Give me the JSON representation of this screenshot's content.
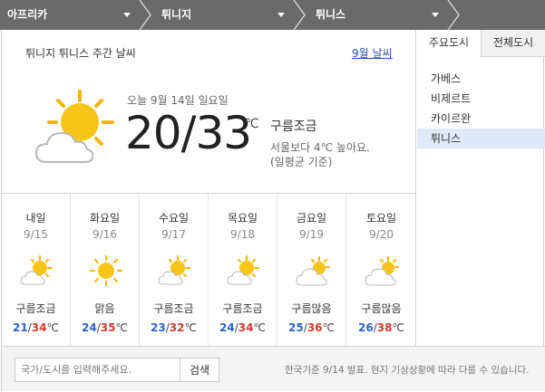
{
  "breadcrumb": {
    "items": [
      {
        "label": "아프리카"
      },
      {
        "label": "튀니지"
      },
      {
        "label": "튀니스"
      }
    ]
  },
  "main": {
    "title": "튀니지 튀니스 주간 날씨",
    "month_link": "9월 날씨"
  },
  "today": {
    "date": "오늘 9월 14일 일요일",
    "temp": "20/33",
    "unit": "℃",
    "condition": "구름조금",
    "compare": "서울보다 4℃ 높아요.",
    "note": "(일평균 기준)",
    "icon": "sun-cloud-icon"
  },
  "forecast": [
    {
      "day": "내일",
      "date": "9/15",
      "icon": "sun-cloud-icon",
      "cond": "구름조금",
      "lo": "21",
      "hi": "34"
    },
    {
      "day": "화요일",
      "date": "9/16",
      "icon": "sun-icon",
      "cond": "맑음",
      "lo": "24",
      "hi": "35"
    },
    {
      "day": "수요일",
      "date": "9/17",
      "icon": "sun-cloud-icon",
      "cond": "구름조금",
      "lo": "23",
      "hi": "32"
    },
    {
      "day": "목요일",
      "date": "9/18",
      "icon": "sun-cloud-icon",
      "cond": "구름조금",
      "lo": "24",
      "hi": "34"
    },
    {
      "day": "금요일",
      "date": "9/19",
      "icon": "cloud-sun-icon",
      "cond": "구름많음",
      "lo": "25",
      "hi": "36"
    },
    {
      "day": "토요일",
      "date": "9/20",
      "icon": "cloud-sun-icon",
      "cond": "구름많음",
      "lo": "26",
      "hi": "38"
    }
  ],
  "forecast_slash": "/",
  "forecast_unit": "℃",
  "sidebar": {
    "tabs": [
      {
        "label": "주요도시",
        "active": true
      },
      {
        "label": "전체도시",
        "active": false
      }
    ],
    "cities": [
      {
        "label": "가베스"
      },
      {
        "label": "비제르트"
      },
      {
        "label": "카이르완"
      },
      {
        "label": "튀니스",
        "selected": true
      }
    ]
  },
  "search": {
    "placeholder": "국가/도시를 입력해주세요.",
    "value": "",
    "button_label": "검색"
  },
  "footnote": "한국기준 9/14 발표. 현지 기상상황에 따라 다를 수 있습니다.",
  "colors": {
    "breadcrumb_bg": "#6a6a6a",
    "low_temp": "#2a64c8",
    "high_temp": "#d63a2e",
    "link": "#2a4fb0",
    "selected_city_bg": "#dfeaf8"
  }
}
